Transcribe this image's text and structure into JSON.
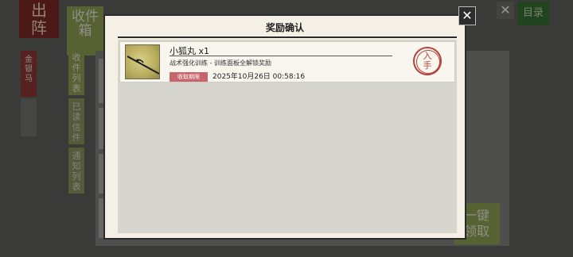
{
  "background": {
    "exit_label": [
      "出",
      "阵"
    ],
    "inbox_tab": [
      "收件",
      "箱"
    ],
    "red_tag": [
      "金",
      "银",
      "马"
    ],
    "side_tabs": [
      {
        "label": [
          "收",
          "件",
          "列",
          "表"
        ]
      },
      {
        "label": [
          "已",
          "读",
          "信",
          "件"
        ]
      },
      {
        "label": [
          "通",
          "知",
          "列",
          "表"
        ]
      }
    ],
    "catalog_label": "目录",
    "claim_all": [
      "一键",
      "领取"
    ],
    "close_glyph": "✕"
  },
  "dialog": {
    "title": "奖励确认",
    "close_glyph": "✕",
    "reward": {
      "name": "小狐丸 x1",
      "description": "战术强化训练 - 训练面板全解锁奖励",
      "period_label": "收取期限",
      "expire_time": "2025年10月26日 00:58:16",
      "seal": [
        "入",
        "手"
      ],
      "thumb_icon": "sword-icon"
    }
  },
  "colors": {
    "accent_green": "#8ca24a",
    "seal_red": "#b6403a",
    "badge_red": "#c8646a"
  }
}
